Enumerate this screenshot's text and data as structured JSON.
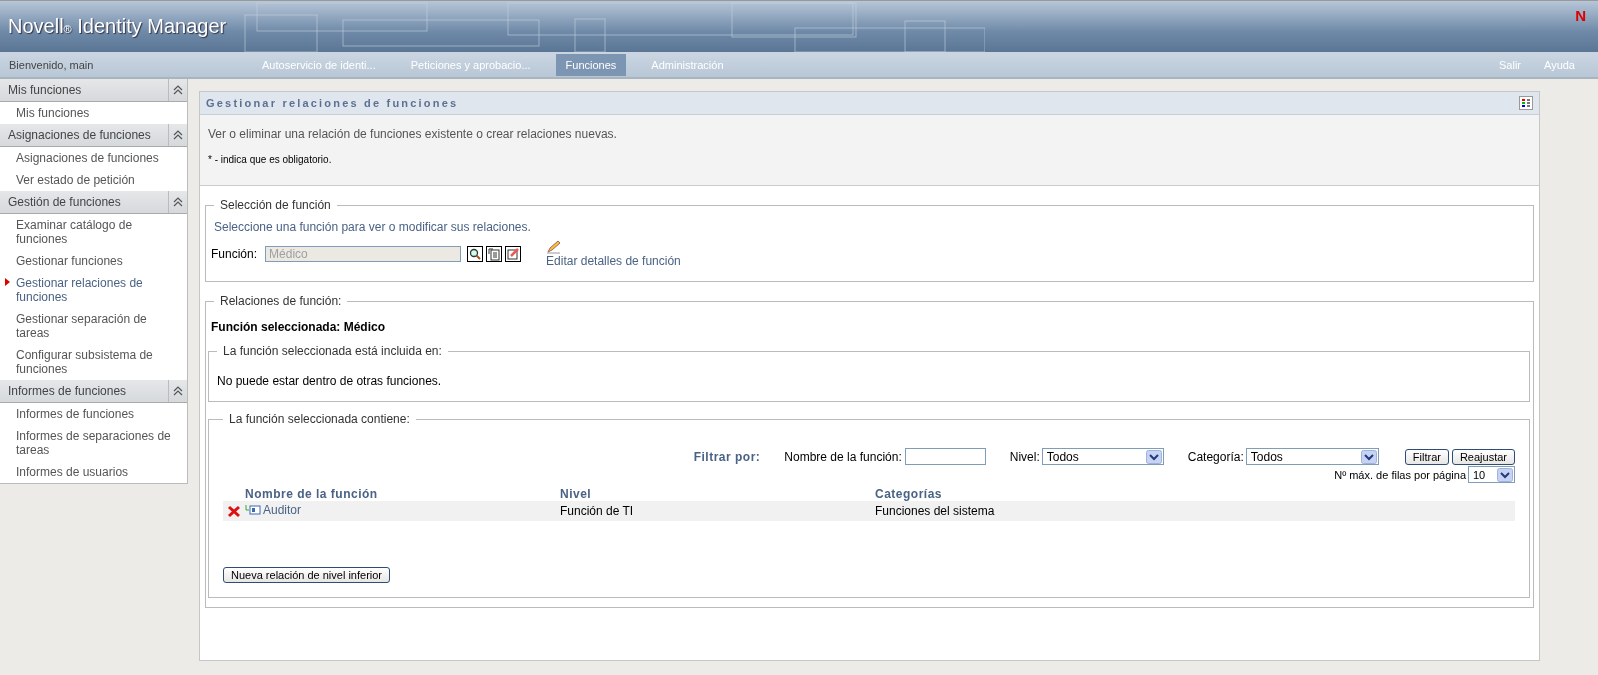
{
  "header": {
    "title": "Novell$_{®}$ Identity Manager",
    "logo_mark": "N"
  },
  "nav": {
    "greeting": "Bienvenido, main",
    "tabs": [
      {
        "label": "Autoservicio de identi...",
        "selected": false
      },
      {
        "label": "Peticiones y aprobacio...",
        "selected": false
      },
      {
        "label": "Funciones",
        "selected": true
      },
      {
        "label": "Administración",
        "selected": false
      }
    ],
    "links": [
      "Salir",
      "Ayuda"
    ]
  },
  "sidebar": {
    "groups": [
      {
        "title": "Mis funciones",
        "expanded": true,
        "items": [
          {
            "label": "Mis funciones",
            "selected": false
          }
        ]
      },
      {
        "title": "Asignaciones de funciones",
        "expanded": true,
        "items": [
          {
            "label": "Asignaciones de funciones",
            "selected": false
          },
          {
            "label": "Ver estado de petición",
            "selected": false
          }
        ]
      },
      {
        "title": "Gestión de funciones",
        "expanded": true,
        "items": [
          {
            "label": "Examinar catálogo de funciones",
            "selected": false
          },
          {
            "label": "Gestionar funciones",
            "selected": false
          },
          {
            "label": "Gestionar relaciones de funciones",
            "selected": true
          },
          {
            "label": "Gestionar separación de tareas",
            "selected": false
          },
          {
            "label": "Configurar subsistema de funciones",
            "selected": false
          }
        ]
      },
      {
        "title": "Informes de funciones",
        "expanded": true,
        "items": [
          {
            "label": "Informes de funciones",
            "selected": false
          },
          {
            "label": "Informes de separaciones de tareas",
            "selected": false
          },
          {
            "label": "Informes de usuarios",
            "selected": false
          }
        ]
      }
    ]
  },
  "panel": {
    "title": "Gestionar relaciones de funciones",
    "description": "Ver o eliminar una relación de funciones existente o crear relaciones nuevas.",
    "required_note": "* - indica que es obligatorio.",
    "selection": {
      "legend": "Selección de función",
      "hint": "Seleccione una función para ver o modificar sus relaciones.",
      "field_label": "Función:",
      "field_value": "Médico",
      "edit_link": "Editar detalles de función"
    },
    "relations": {
      "legend": "Relaciones de función:",
      "selected_role": "Función seleccionada: Médico",
      "included_in": {
        "legend": "La función seleccionada está incluida en:",
        "message": "No puede estar dentro de otras funciones."
      },
      "contains": {
        "legend": "La función seleccionada contiene:",
        "filter": {
          "label": "Filtrar por:",
          "name_label": "Nombre de la función:",
          "level_label": "Nivel:",
          "level_value": "Todos",
          "category_label": "Categoría:",
          "category_value": "Todos",
          "buttons": [
            "Filtrar",
            "Reajustar"
          ],
          "rows_label": "Nº máx. de filas por página",
          "rows_value": "10"
        },
        "table": {
          "columns": [
            "Nombre de la función",
            "Nivel",
            "Categorías"
          ],
          "rows": [
            {
              "name": "Auditor",
              "level": "Función de TI",
              "categories": "Funciones del sistema"
            }
          ]
        },
        "add_button": "Nueva relación de nivel inferior"
      }
    }
  }
}
